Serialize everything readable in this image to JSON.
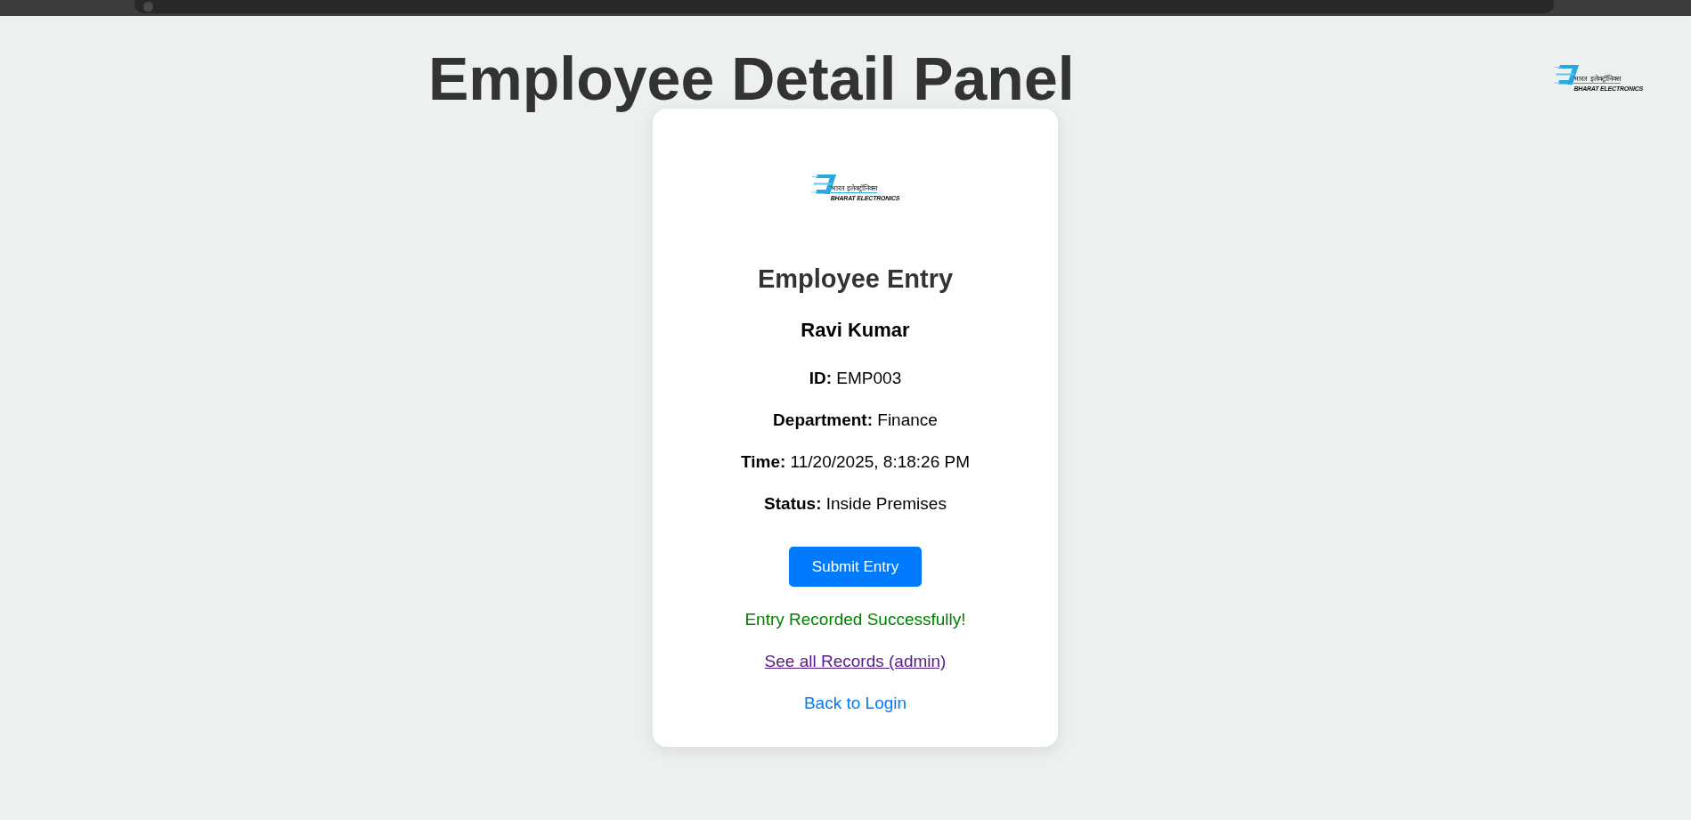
{
  "header": {
    "title": "Employee Detail Panel",
    "logo": {
      "hindi": "भारत इलेक्ट्रॉनिक्स",
      "name": "BHARAT ELECTRONICS"
    }
  },
  "card": {
    "logo": {
      "hindi": "भारत इलेक्ट्रॉनिक्स",
      "name": "BHARAT ELECTRONICS"
    },
    "heading": "Employee Entry",
    "employee_name": "Ravi Kumar",
    "fields": [
      {
        "label": "ID:",
        "value": "EMP003"
      },
      {
        "label": "Department:",
        "value": "Finance"
      },
      {
        "label": "Time:",
        "value": "11/20/2025, 8:18:26 PM"
      },
      {
        "label": "Status:",
        "value": "Inside Premises"
      }
    ],
    "submit_button": "Submit Entry",
    "message": {
      "kind": "success",
      "text": "Entry Recorded Successfully!"
    },
    "links": [
      {
        "kind": "anchor",
        "label": "See all Records (admin)",
        "visited": true
      },
      {
        "kind": "action",
        "label": "Back to Login",
        "visited": false
      }
    ]
  }
}
